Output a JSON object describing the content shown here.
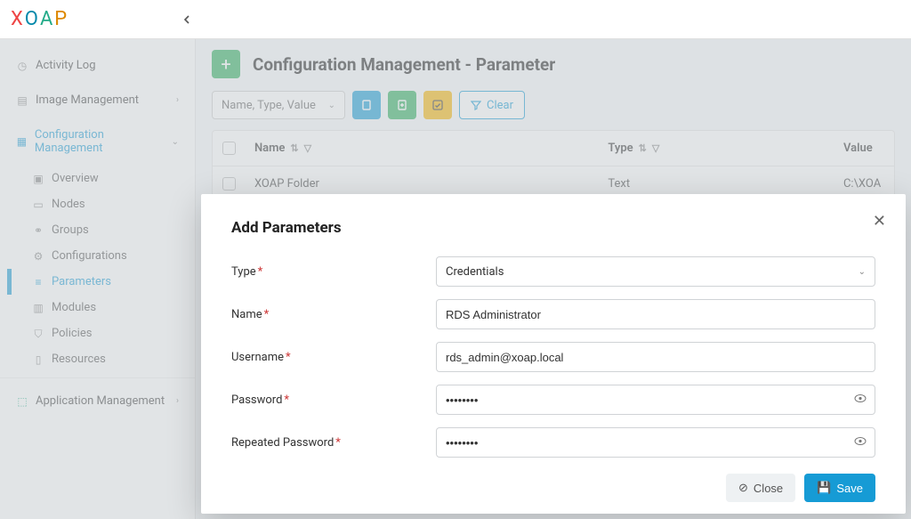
{
  "brand": {
    "letters": [
      "X",
      "O",
      "A",
      "P"
    ]
  },
  "sidebar": {
    "activity": "Activity Log",
    "image_mgmt": "Image Management",
    "config_mgmt": "Configuration Management",
    "app_mgmt": "Application Management",
    "items": [
      {
        "label": "Overview"
      },
      {
        "label": "Nodes"
      },
      {
        "label": "Groups"
      },
      {
        "label": "Configurations"
      },
      {
        "label": "Parameters"
      },
      {
        "label": "Modules"
      },
      {
        "label": "Policies"
      },
      {
        "label": "Resources"
      }
    ]
  },
  "page": {
    "title": "Configuration Management - Parameter"
  },
  "toolbar": {
    "picker_text": "Name, Type, Value",
    "clear_label": "Clear"
  },
  "table": {
    "columns": {
      "name": "Name",
      "type": "Type",
      "value": "Value"
    },
    "rows": [
      {
        "name": "XOAP Folder",
        "type": "Text",
        "value": "C:\\XOA"
      }
    ]
  },
  "modal": {
    "title": "Add Parameters",
    "labels": {
      "type": "Type",
      "name": "Name",
      "username": "Username",
      "password": "Password",
      "repeated": "Repeated Password"
    },
    "values": {
      "type": "Credentials",
      "name": "RDS Administrator",
      "username": "rds_admin@xoap.local",
      "password": "••••••••",
      "repeated": "••••••••"
    },
    "buttons": {
      "close": "Close",
      "save": "Save"
    }
  }
}
